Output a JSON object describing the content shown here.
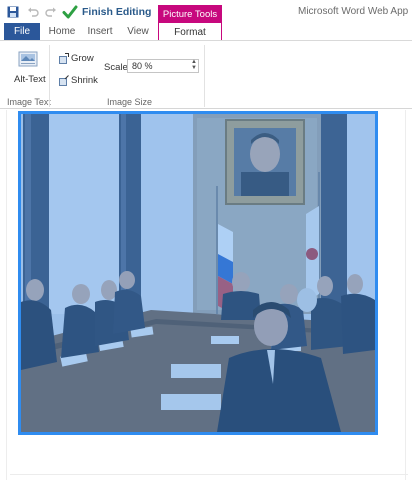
{
  "app": {
    "title": "Microsoft Word Web App",
    "finish_editing_label": "Finish Editing",
    "context_tab_header": "Picture Tools"
  },
  "tabs": [
    {
      "label": "File"
    },
    {
      "label": "Home"
    },
    {
      "label": "Insert"
    },
    {
      "label": "View"
    },
    {
      "label": "Format"
    }
  ],
  "ribbon": {
    "alt_text_label": "Alt-Text",
    "grow_label": "Grow",
    "shrink_label": "Shrink",
    "scale_label": "Scale:",
    "scale_value": "80 %",
    "group_image_text": "Image Text",
    "group_image_size": "Image Size"
  },
  "colors": {
    "file_tab": "#2b579a",
    "picture_tools": "#c7087d",
    "selection_border": "#2f8cf0",
    "selection_tint": "#3d8fe6"
  },
  "icons": {
    "save": "save-icon",
    "undo": "undo-icon",
    "redo": "redo-icon",
    "finish": "checkmark-icon",
    "alt_text": "alt-text-icon",
    "grow": "grow-icon",
    "shrink": "shrink-icon",
    "spin": "spin-arrows-icon"
  }
}
